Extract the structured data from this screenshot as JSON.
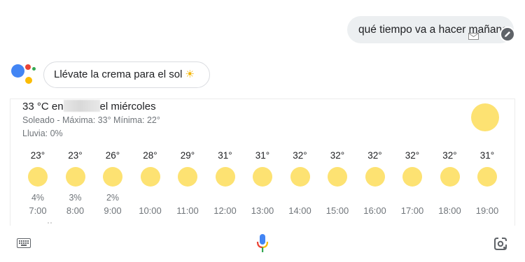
{
  "query": {
    "text": "qué tiempo va a hacer mañana"
  },
  "icons": {
    "query_status": "envelope-icon",
    "edit": "edit-pencil-icon",
    "assistant": "google-assistant-logo-icon",
    "keyboard": "keyboard-icon",
    "mic": "microphone-icon",
    "lens": "google-lens-icon",
    "condition": "sun-icon"
  },
  "suggestion": {
    "text": "Llévate la crema para el sol",
    "emoji": "☀"
  },
  "weather": {
    "temp_prefix": "33 °C en",
    "day": "el miércoles",
    "summary": "Soleado - Máxima: 33° Mínima: 22°",
    "rain": "Lluvia: 0%",
    "hourly": [
      {
        "temp": "23°",
        "precip": "4%",
        "time": "7:00"
      },
      {
        "temp": "23°",
        "precip": "3%",
        "time": "8:00"
      },
      {
        "temp": "26°",
        "precip": "2%",
        "time": "9:00"
      },
      {
        "temp": "28°",
        "precip": "",
        "time": "10:00"
      },
      {
        "temp": "29°",
        "precip": "",
        "time": "11:00"
      },
      {
        "temp": "31°",
        "precip": "",
        "time": "12:00"
      },
      {
        "temp": "31°",
        "precip": "",
        "time": "13:00"
      },
      {
        "temp": "32°",
        "precip": "",
        "time": "14:00"
      },
      {
        "temp": "32°",
        "precip": "",
        "time": "15:00"
      },
      {
        "temp": "32°",
        "precip": "",
        "time": "16:00"
      },
      {
        "temp": "32°",
        "precip": "",
        "time": "17:00"
      },
      {
        "temp": "32°",
        "precip": "",
        "time": "18:00"
      },
      {
        "temp": "31°",
        "precip": "",
        "time": "19:00"
      }
    ]
  },
  "colors": {
    "sun": "#fde272",
    "google_blue": "#4285f4",
    "google_red": "#ea4335",
    "google_yellow": "#fbbc05",
    "google_green": "#34a853",
    "bubble": "#eceff1"
  }
}
